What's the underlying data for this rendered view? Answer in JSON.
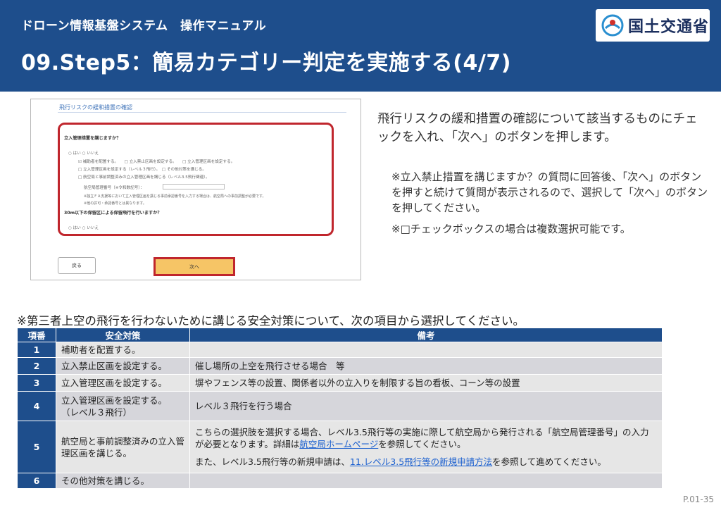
{
  "header": {
    "subtitle": "ドローン情報基盤システム　操作マニュアル",
    "title": "09.Step5：簡易カテゴリー判定を実施する(4/7)",
    "logo_text": "国土交通省"
  },
  "screenshot": {
    "section_title": "飛行リスクの緩和措置の確認",
    "question1": "立入管理措置を講じますか？",
    "q1_yes": "○ はい ○ いいえ",
    "options": [
      "☑ 補助者を配置する。　　□ 立入禁止区画を設定する。　　□ 立入管理区画を設定する。",
      "□ 立入管理区画を設定する（レベル３飛行）。　□ その他対策を講じる。",
      "□ 航空局と事前調整済みの立入管理区画を講じる（レベル3.5飛行関連）。",
      "航空局管理番号（※令和数記号）：",
      "※独立ＦＡ支援等において立入管理区画を講じる事前承認番号を入力する場合は、航空局への事前調整が必要です。",
      "※他の許可・承認番号とは異なります。"
    ],
    "question2": "30m以下の保留区による保留飛行を行いますか？",
    "q2_yes": "○ はい ○ いいえ",
    "back_label": "戻る",
    "next_label": "次へ"
  },
  "description": "飛行リスクの緩和措置の確認について該当するものにチェックを入れ、「次へ」のボタンを押します。",
  "note1": "※立入禁止措置を講じますか？の質問に回答後、「次へ」のボタンを押すと続けて質問が表示されるので、選択して「次へ」のボタンを押してください。",
  "note2": "※□チェックボックスの場合は複数選択可能です。",
  "caption": "※第三者上空の飛行を行わないために講じる安全対策について、次の項目から選択してください。",
  "table": {
    "headers": [
      "項番",
      "安全対策",
      "備考"
    ],
    "rows": [
      {
        "no": "1",
        "measure": "補助者を配置する。",
        "remark": ""
      },
      {
        "no": "2",
        "measure": "立入禁止区画を設定する。",
        "remark": "催し場所の上空を飛行させる場合　等"
      },
      {
        "no": "3",
        "measure": "立入管理区画を設定する。",
        "remark": "塀やフェンス等の設置、関係者以外の立入りを制限する旨の看板、コーン等の設置"
      },
      {
        "no": "4",
        "measure": "立入管理区画を設定する。\n（レベル３飛行）",
        "remark": "レベル３飛行を行う場合"
      },
      {
        "no": "5",
        "measure": "航空局と事前調整済みの立入管理区画を講じる。",
        "remark_a": "こちらの選択肢を選択する場合、レベル3.5飛行等の実施に際して航空局から発行される「航空局管理番号」の入力が必要となります。詳細は",
        "remark_link1": "航空局ホームページ",
        "remark_b": "を参照してください。",
        "remark_c": "また、レベル3.5飛行等の新規申請は、",
        "remark_link2": "11.レベル3.5飛行等の新規申請方法",
        "remark_d": "を参照して進めてください。"
      },
      {
        "no": "6",
        "measure": "その他対策を講じる。",
        "remark": ""
      }
    ]
  },
  "page_number": "P.01-35"
}
